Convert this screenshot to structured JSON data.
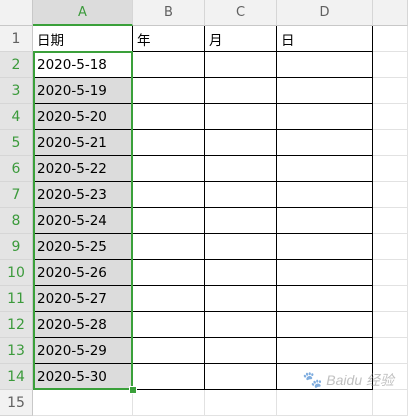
{
  "columns": [
    "A",
    "B",
    "C",
    "D"
  ],
  "rows": [
    "1",
    "2",
    "3",
    "4",
    "5",
    "6",
    "7",
    "8",
    "9",
    "10",
    "11",
    "12",
    "13",
    "14",
    "15"
  ],
  "header_row": [
    "日期",
    "年",
    "月",
    "日"
  ],
  "dates": [
    "2020-5-18",
    "2020-5-19",
    "2020-5-20",
    "2020-5-21",
    "2020-5-22",
    "2020-5-23",
    "2020-5-24",
    "2020-5-25",
    "2020-5-26",
    "2020-5-27",
    "2020-5-28",
    "2020-5-29",
    "2020-5-30"
  ],
  "selection": {
    "column": "A",
    "first_row": 2,
    "last_row": 14,
    "active_cell": "A2"
  },
  "colors": {
    "selection": "#3aa03a",
    "selected_fill": "#dcdcdc",
    "header_bg": "#f2f2f2"
  },
  "watermark": {
    "text": "Baidu 经验",
    "icon": "paw-icon"
  }
}
